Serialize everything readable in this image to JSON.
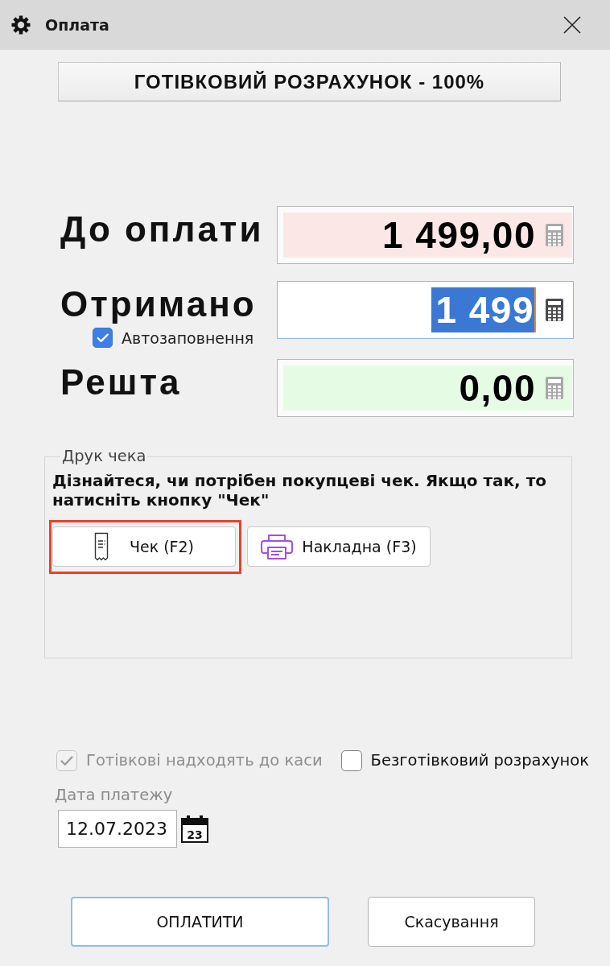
{
  "window": {
    "title": "Оплата"
  },
  "payment_type": {
    "label": "ГОТІВКОВИЙ РОЗРАХУНОК - 100%"
  },
  "amounts": [
    {
      "kind": "due",
      "label": "До оплати",
      "value": "1 499,00",
      "focused": false,
      "value_selected": false
    },
    {
      "kind": "received",
      "label": "Отримано",
      "value": "1 499",
      "focused": true,
      "value_selected": true,
      "autofill": {
        "label": "Автозаповнення",
        "checked": true
      }
    },
    {
      "kind": "change",
      "label": "Решта",
      "value": "0,00",
      "focused": false,
      "value_selected": false
    }
  ],
  "receipt_group": {
    "title": "Друк чека",
    "instruction": "Дізнайтеся, чи потрібен покупцеві чек. Якщо так, то натисніть кнопку \"Чек\"",
    "buttons": [
      {
        "kind": "receipt",
        "label": "Чек (F2)",
        "highlighted": true
      },
      {
        "kind": "invoice",
        "label": "Накладна (F3)",
        "highlighted": false
      }
    ]
  },
  "options": [
    {
      "label": "Готівкові надходять до каси",
      "checked": true,
      "disabled": true
    },
    {
      "label": "Безготівковий розрахунок",
      "checked": false,
      "disabled": false
    }
  ],
  "payment_date": {
    "label": "Дата платежу",
    "value": "12.07.2023",
    "calendar_day": "23"
  },
  "buttons": [
    {
      "kind": "pay",
      "label": "ОПЛАТИТИ",
      "default": true
    },
    {
      "kind": "cancel",
      "label": "Скасування",
      "default": false
    }
  ]
}
